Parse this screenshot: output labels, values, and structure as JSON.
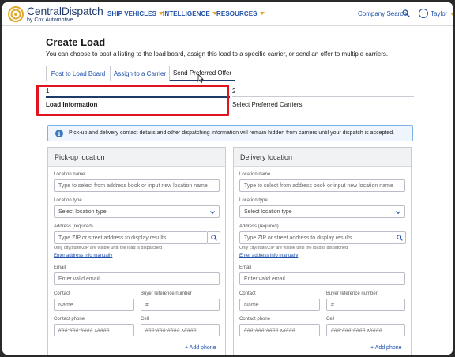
{
  "brand": {
    "name": "CentralDispatch",
    "sub": "by Cox Automotive"
  },
  "nav": {
    "menus": [
      "SHIP VEHICLES",
      "INTELLIGENCE",
      "RESOURCES"
    ],
    "company_search": "Company Search",
    "user": "Taylor"
  },
  "page": {
    "title": "Create Load",
    "description": "You can choose to post a listing to the load board, assign this load to a specific carrier, or send an offer to multiple carriers."
  },
  "tabs": [
    "Post to Load Board",
    "Assign to a Carrier",
    "Send Preferred Offer"
  ],
  "steps": [
    {
      "num": "1",
      "label": "Load Information"
    },
    {
      "num": "2",
      "label": "Select Preferred Carriers"
    }
  ],
  "info": "Pick-up and delivery contact details and other dispatching information will remain hidden from carriers until your dispatch is accepted.",
  "pickup": {
    "title": "Pick-up location",
    "location_name_label": "Location name",
    "location_name_placeholder": "Type to select from address book or input new location name",
    "location_type_label": "Location type",
    "location_type_value": "Select location type",
    "address_label": "Address",
    "address_required": "(required)",
    "address_placeholder": "Type ZIP or street address to display results",
    "address_hint": "Only city/state/ZIP are visible until the load is dispatched",
    "manual_link": "Enter address info manually",
    "email_label": "Email",
    "email_placeholder": "Enter valid email",
    "contact_label": "Contact",
    "contact_placeholder": "Name",
    "buyer_ref_label": "Buyer reference number",
    "buyer_ref_placeholder": "#",
    "phone_label": "Contact phone",
    "phone_placeholder": "###-###-#### x####",
    "cell_label": "Cell",
    "cell_placeholder": "###-###-#### x####",
    "add_phone": "+ Add phone"
  },
  "delivery": {
    "title": "Delivery location",
    "location_name_label": "Location name",
    "location_name_placeholder": "Type to select from address book or input new location name",
    "location_type_label": "Location type",
    "location_type_value": "Select location type",
    "address_label": "Address",
    "address_required": "(required)",
    "address_placeholder": "Type ZIP or street address to display results",
    "address_hint": "Only city/state/ZIP are visible until the load is dispatched",
    "manual_link": "Enter address info manually",
    "email_label": "Email",
    "email_placeholder": "Enter valid email",
    "contact_label": "Contact",
    "contact_placeholder": "Name",
    "buyer_ref_label": "Buyer reference number",
    "buyer_ref_placeholder": "#",
    "phone_label": "Contact phone",
    "phone_placeholder": "###-###-#### x####",
    "cell_label": "Cell",
    "cell_placeholder": "###-###-#### x####",
    "add_phone": "+ Add phone"
  },
  "colors": {
    "brand_blue": "#1f4fa8",
    "accent_orange": "#e0a82e",
    "highlight_red": "#e0141e"
  }
}
